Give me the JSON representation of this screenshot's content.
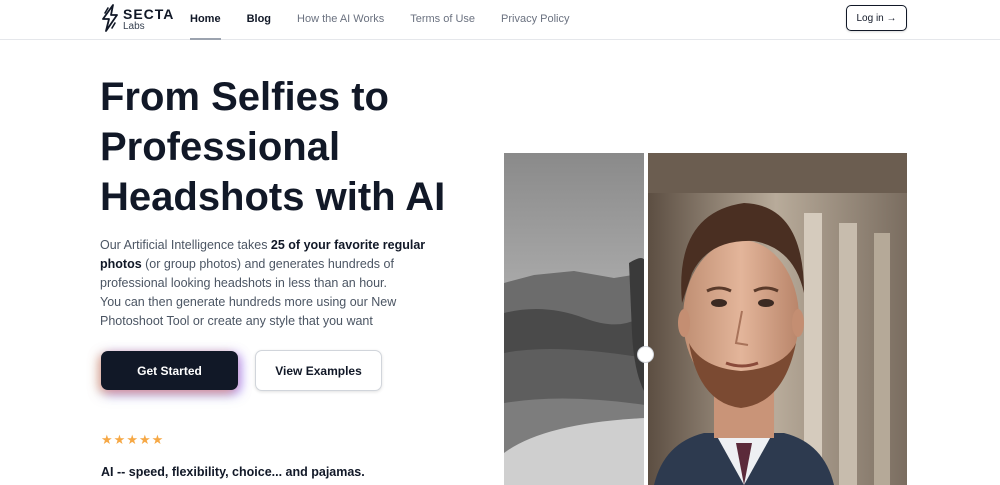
{
  "brand": {
    "name": "SECTA",
    "sub": "Labs"
  },
  "nav": {
    "links": [
      {
        "label": "Home"
      },
      {
        "label": "Blog"
      },
      {
        "label": "How the AI Works"
      },
      {
        "label": "Terms of Use"
      },
      {
        "label": "Privacy Policy"
      }
    ],
    "login_label": "Log in →"
  },
  "hero": {
    "title": "From Selfies to Professional Headshots with AI",
    "desc_1": "Our Artificial Intelligence takes ",
    "desc_bold": "25 of your favorite regular photos",
    "desc_2": " (or group photos) and generates hundreds of professional looking headshots in less than an hour.",
    "desc_3": "You can then generate hundreds more using our New Photoshoot Tool or create any style that you want",
    "cta_primary": "Get Started",
    "cta_secondary": "View Examples",
    "stars": [
      "★",
      "★",
      "★",
      "★",
      "★"
    ],
    "tagline": "AI -- speed, flexibility, choice... and pajamas."
  },
  "colors": {
    "primary": "#111827",
    "star": "#f6a845",
    "muted": "#6b7280"
  }
}
